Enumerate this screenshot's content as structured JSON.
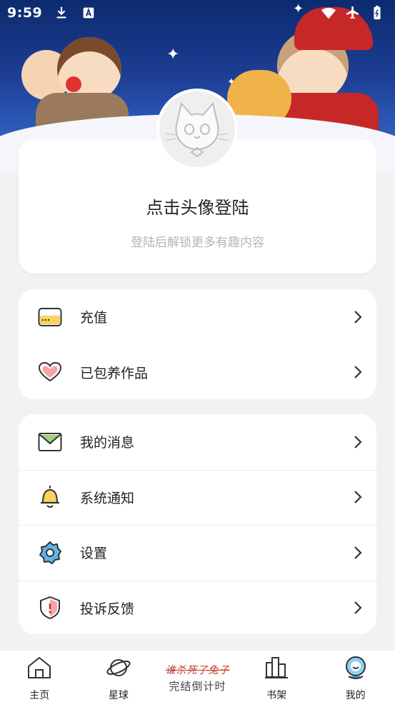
{
  "status_bar": {
    "time": "9:59",
    "icons": [
      "download-icon",
      "a-icon",
      "wifi-icon",
      "airplane-icon",
      "battery-icon"
    ]
  },
  "profile": {
    "title": "点击头像登陆",
    "subtitle": "登陆后解锁更多有趣内容"
  },
  "menu_group_1": [
    {
      "label": "充值",
      "icon": "card-icon"
    },
    {
      "label": "已包养作品",
      "icon": "heart-icon"
    }
  ],
  "menu_group_2": [
    {
      "label": "我的消息",
      "icon": "mail-icon"
    },
    {
      "label": "系统通知",
      "icon": "bell-icon"
    },
    {
      "label": "设置",
      "icon": "gear-icon"
    },
    {
      "label": "投诉反馈",
      "icon": "shield-icon"
    }
  ],
  "bottom_nav": {
    "home": "主页",
    "planet": "星球",
    "promo_top": "谁杀死了兔子",
    "promo_bottom": "完结倒计时",
    "shelf": "书架",
    "mine": "我的"
  },
  "colors": {
    "banner_dark": "#0c2a6e",
    "banner_light": "#3c6bc6",
    "background": "#f2f2f4",
    "accent_blue": "#3aa0e0"
  }
}
